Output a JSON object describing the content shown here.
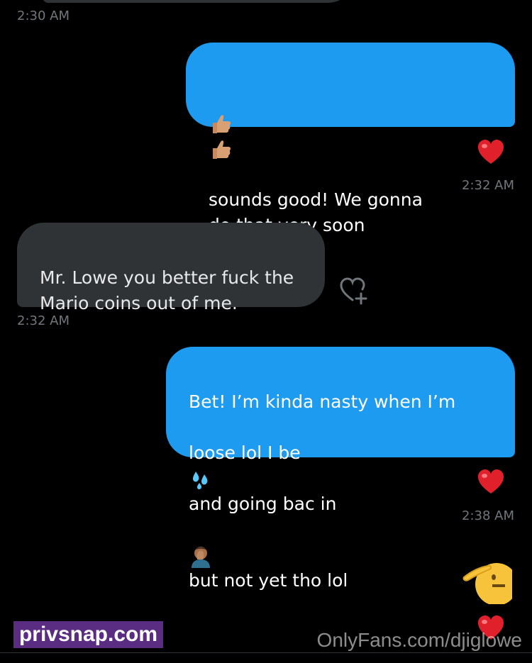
{
  "messages": [
    {
      "time": "2:30 AM"
    },
    {
      "text": "sounds good! We gonna\ndo that very soon",
      "time": "2:32 AM"
    },
    {
      "text": "Mr. Lowe you better fuck the\nMario coins out of me.",
      "time": "2:32 AM"
    },
    {
      "text_line1": "Bet! I’m kinda nasty when I’m",
      "text_line2a": "loose lol I be",
      "text_line2b": "and going bac in",
      "text_line3": "but not yet tho lol",
      "time": "2:38 AM"
    }
  ],
  "watermarks": {
    "left": "privsnap.com",
    "right": "OnlyFans.com/djiglowe"
  },
  "colors": {
    "sent_bubble": "#1d9bf0",
    "recv_bubble": "#2f3336",
    "background": "#000000",
    "timestamp": "#71767b"
  }
}
